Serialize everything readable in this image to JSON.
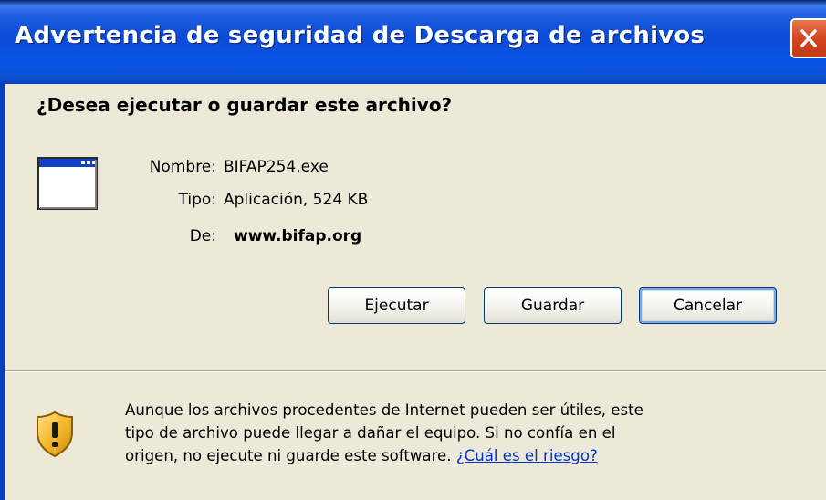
{
  "window": {
    "title": "Advertencia de seguridad de Descarga de archivos"
  },
  "dialog": {
    "question": "¿Desea ejecutar o guardar este archivo?",
    "file_info": {
      "name_label": "Nombre:",
      "name_value": "BIFAP254.exe",
      "type_label": "Tipo:",
      "type_value": "Aplicación, 524 KB",
      "from_label": "De:",
      "from_value": "www.bifap.org"
    },
    "buttons": {
      "run": "Ejecutar",
      "save": "Guardar",
      "cancel": "Cancelar"
    },
    "warning": {
      "line1": "Aunque los archivos procedentes de Internet pueden ser útiles, este",
      "line2": "tipo de archivo puede llegar a dañar el equipo. Si no confía en el",
      "line3": "origen, no ejecute ni guarde este software. ",
      "link": "¿Cuál es el riesgo?"
    }
  },
  "icons": {
    "close": "close-icon",
    "file": "application-window-icon",
    "warning": "security-shield-icon"
  },
  "colors": {
    "titlebar": "#0a4ad6",
    "dialog_bg": "#ece9d8",
    "close_button": "#d4461e",
    "link": "#0033cc",
    "button_border": "#003c74"
  }
}
